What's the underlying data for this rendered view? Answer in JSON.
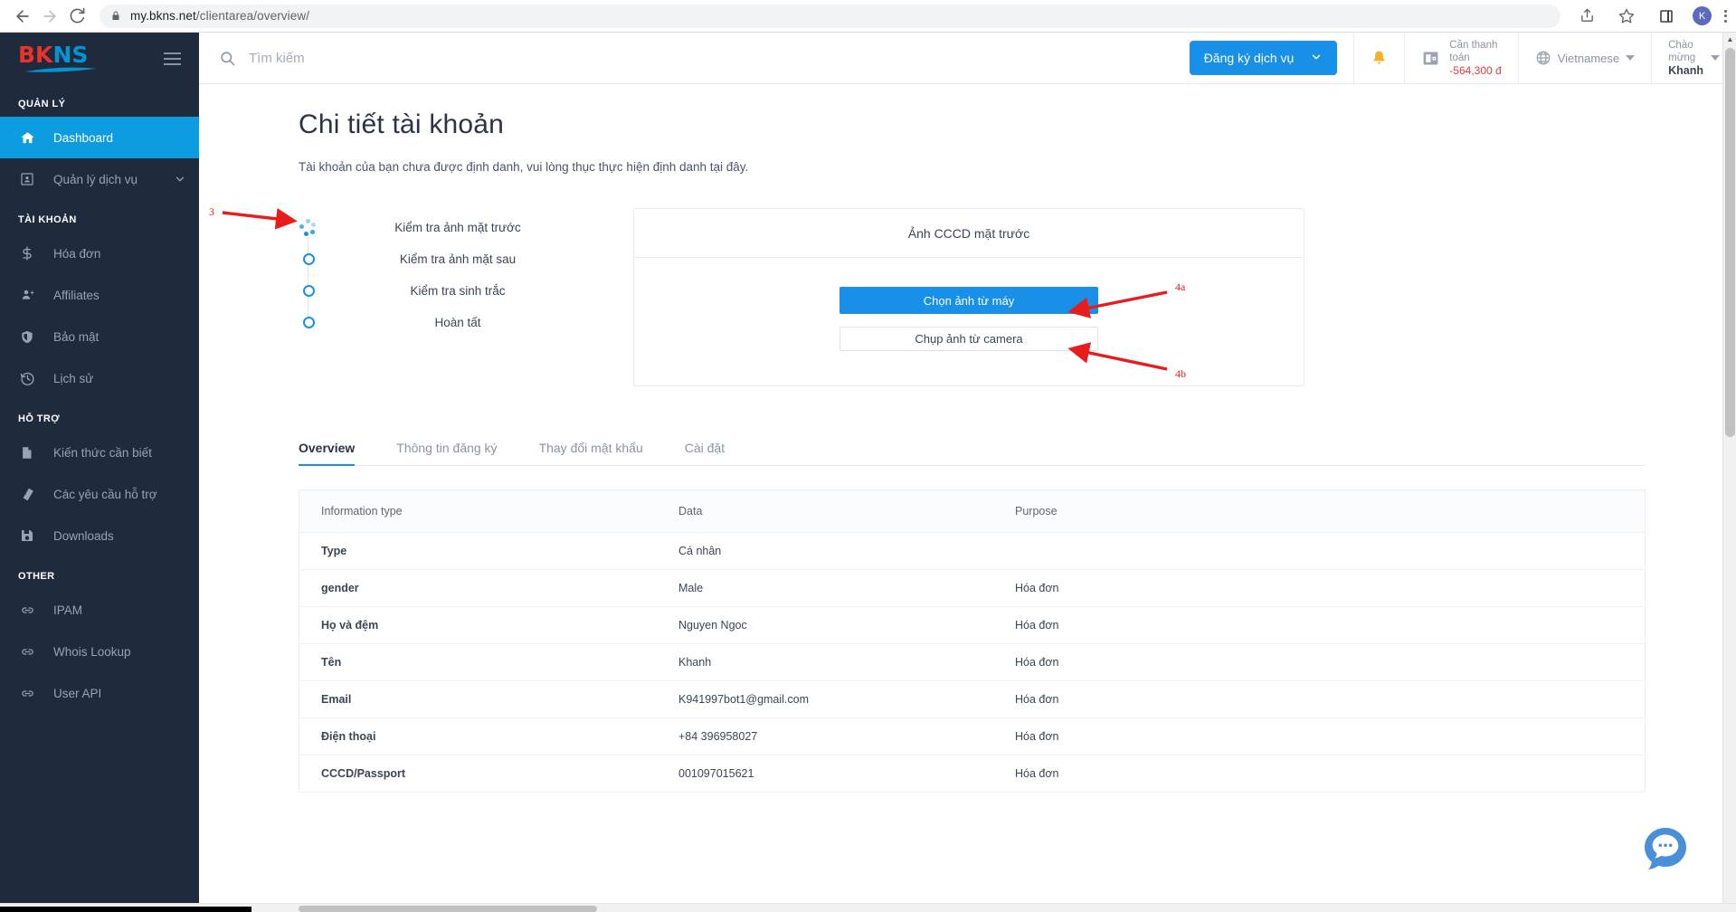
{
  "browser": {
    "url_prefix": "my.bkns.net",
    "url_suffix": "/clientarea/overview/",
    "back_icon": "back-arrow-icon",
    "forward_icon": "forward-arrow-icon",
    "reload_icon": "reload-icon",
    "lock_icon": "lock-icon",
    "share_icon": "share-icon",
    "bookmark_icon": "star-icon",
    "sidepanel_icon": "side-panel-icon",
    "profile_initial": "K",
    "menu_icon": "kebab-menu-icon"
  },
  "sidebar": {
    "logo": {
      "bk": "BK",
      "n": "N",
      "s": "S"
    },
    "menu_icon": "hamburger-icon",
    "sections": [
      {
        "title": "QUẢN LÝ",
        "items": [
          {
            "label": "Dashboard",
            "icon": "home-icon",
            "active": true,
            "chevron": false
          },
          {
            "label": "Quản lý dịch vụ",
            "icon": "id-card-icon",
            "active": false,
            "chevron": true
          }
        ]
      },
      {
        "title": "TÀI KHOẢN",
        "items": [
          {
            "label": "Hóa đơn",
            "icon": "dollar-icon",
            "active": false,
            "chevron": false
          },
          {
            "label": "Affiliates",
            "icon": "user-add-icon",
            "active": false,
            "chevron": false
          },
          {
            "label": "Bảo mật",
            "icon": "shield-icon",
            "active": false,
            "chevron": false
          },
          {
            "label": "Lịch sử",
            "icon": "history-icon",
            "active": false,
            "chevron": false
          }
        ]
      },
      {
        "title": "HỖ TRỢ",
        "items": [
          {
            "label": "Kiến thức cần biết",
            "icon": "document-icon",
            "active": false,
            "chevron": false
          },
          {
            "label": "Các yêu cầu hỗ trợ",
            "icon": "ticket-icon",
            "active": false,
            "chevron": false
          },
          {
            "label": "Downloads",
            "icon": "save-disk-icon",
            "active": false,
            "chevron": false
          }
        ]
      },
      {
        "title": "OTHER",
        "items": [
          {
            "label": "IPAM",
            "icon": "link-icon",
            "active": false,
            "chevron": false
          },
          {
            "label": "Whois Lookup",
            "icon": "link-icon",
            "active": false,
            "chevron": false
          },
          {
            "label": "User API",
            "icon": "link-icon",
            "active": false,
            "chevron": false
          }
        ]
      }
    ]
  },
  "topbar": {
    "search_placeholder": "Tìm kiếm",
    "search_value": "",
    "search_icon": "search-icon",
    "register_button": "Đăng ký dịch vụ",
    "register_caret": "chevron-down-icon",
    "bell_icon": "bell-icon",
    "payment": {
      "icon": "wallet-icon",
      "label_line1": "Cần thanh",
      "label_line2": "toán",
      "amount": "-564,300 đ"
    },
    "language": {
      "icon": "globe-icon",
      "value": "Vietnamese",
      "caret": "caret-down-icon"
    },
    "user": {
      "greet_line1": "Chào",
      "greet_line2": "mừng",
      "name": "Khanh",
      "caret": "caret-down-icon"
    }
  },
  "page": {
    "title": "Chi tiết tài khoản",
    "subtitle": "Tài khoản của bạn chưa được định danh, vui lòng thục thực hiện định danh tại đây."
  },
  "kyc": {
    "steps": [
      {
        "label": "Kiểm tra ảnh mặt trước",
        "state": "loading"
      },
      {
        "label": "Kiểm tra ảnh mặt sau",
        "state": "pending"
      },
      {
        "label": "Kiểm tra sinh trắc",
        "state": "pending"
      },
      {
        "label": "Hoàn tất",
        "state": "pending"
      }
    ],
    "card_title": "Ảnh CCCD mặt trước",
    "primary_button": "Chọn ảnh từ máy",
    "secondary_button": "Chụp ảnh từ camera"
  },
  "tabs": [
    {
      "label": "Overview",
      "active": true
    },
    {
      "label": "Thông tin đăng ký",
      "active": false
    },
    {
      "label": "Thay đổi mật khẩu",
      "active": false
    },
    {
      "label": "Cài đặt",
      "active": false
    }
  ],
  "table": {
    "headers": [
      "Information type",
      "Data",
      "Purpose"
    ],
    "rows": [
      {
        "type": "Type",
        "data": "Cá nhân",
        "purpose": ""
      },
      {
        "type": "gender",
        "data": "Male",
        "purpose": "Hóa đơn"
      },
      {
        "type": "Họ và đệm",
        "data": "Nguyen Ngoc",
        "purpose": "Hóa đơn"
      },
      {
        "type": "Tên",
        "data": "Khanh",
        "purpose": "Hóa đơn"
      },
      {
        "type": "Email",
        "data": "K941997bot1@gmail.com",
        "purpose": "Hóa đơn"
      },
      {
        "type": "Điện thoại",
        "data": "+84 396958027",
        "purpose": "Hóa đơn"
      },
      {
        "type": "CCCD/Passport",
        "data": "001097015621",
        "purpose": "Hóa đơn"
      }
    ]
  },
  "annotations": [
    {
      "id": "3",
      "target": "kyc-step-spinner"
    },
    {
      "id": "4a",
      "target": "choose-photo-from-device-button"
    },
    {
      "id": "4b",
      "target": "capture-photo-from-camera-button"
    }
  ],
  "chat": {
    "icon": "chat-bubble-icon",
    "color": "#4a90d9"
  },
  "colors": {
    "accent": "#1890e8",
    "sidebar_bg": "#1f2a3d",
    "annotation": "#e81c1c",
    "amount_negative": "#e23b3b"
  }
}
